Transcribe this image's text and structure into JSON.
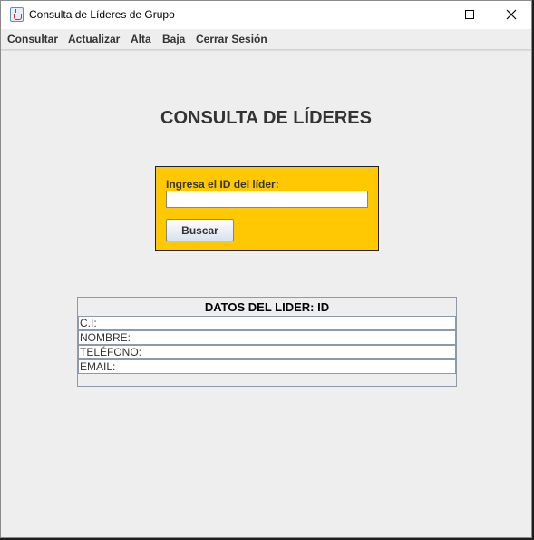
{
  "window": {
    "title": "Consulta de Líderes de Grupo"
  },
  "menu": {
    "items": [
      "Consultar",
      "Actualizar",
      "Alta",
      "Baja",
      "Cerrar Sesión"
    ]
  },
  "page": {
    "title": "CONSULTA DE LÍDERES"
  },
  "search": {
    "label": "Ingresa el ID del líder:",
    "value": "",
    "placeholder": "",
    "button_label": "Buscar",
    "panel_color": "#ffc800"
  },
  "details": {
    "header": "DATOS DEL LIDER: ID",
    "fields": [
      "C.I:",
      "NOMBRE:",
      "TELÉFONO:",
      "EMAIL:"
    ]
  }
}
